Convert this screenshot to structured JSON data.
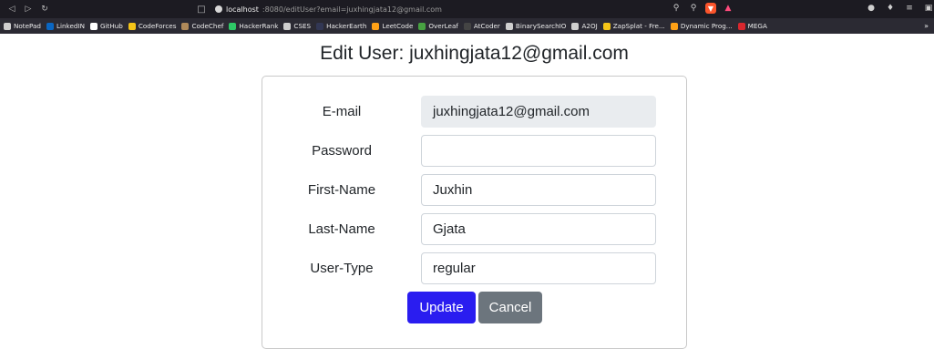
{
  "browser": {
    "url_host": "localhost",
    "url_path": ":8080/editUser?email=juxhingjata12@gmail.com"
  },
  "bookmarks": [
    {
      "label": "NotePad",
      "icon": "notepad-icon",
      "color": "#cfcfcf"
    },
    {
      "label": "LinkedIN",
      "icon": "linkedin-icon",
      "color": "#0a66c2"
    },
    {
      "label": "GitHub",
      "icon": "github-icon",
      "color": "#ffffff"
    },
    {
      "label": "CodeForces",
      "icon": "codeforces-icon",
      "color": "#f5c518"
    },
    {
      "label": "CodeChef",
      "icon": "codechef-icon",
      "color": "#b08a5a"
    },
    {
      "label": "HackerRank",
      "icon": "hackerrank-icon",
      "color": "#2ec866"
    },
    {
      "label": "CSES",
      "icon": "cses-icon",
      "color": "#cfcfcf"
    },
    {
      "label": "HackerEarth",
      "icon": "hackerearth-icon",
      "color": "#323754"
    },
    {
      "label": "LeetCode",
      "icon": "leetcode-icon",
      "color": "#ffa116"
    },
    {
      "label": "OverLeaf",
      "icon": "overleaf-icon",
      "color": "#47a141"
    },
    {
      "label": "AtCoder",
      "icon": "atcoder-icon",
      "color": "#444444"
    },
    {
      "label": "BinarySearchIO",
      "icon": "binarysearch-icon",
      "color": "#cfcfcf"
    },
    {
      "label": "A2OJ",
      "icon": "a2oj-icon",
      "color": "#cfcfcf"
    },
    {
      "label": "ZapSplat - Fre...",
      "icon": "zapsplat-icon",
      "color": "#f5c518"
    },
    {
      "label": "Dynamic Prog...",
      "icon": "dynamic-prog-icon",
      "color": "#ffa116"
    },
    {
      "label": "MEGA",
      "icon": "mega-icon",
      "color": "#d9272e"
    }
  ],
  "page": {
    "title": "Edit User: juxhingjata12@gmail.com"
  },
  "form": {
    "email_label": "E-mail",
    "email_value": "juxhingjata12@gmail.com",
    "password_label": "Password",
    "password_value": "",
    "first_name_label": "First-Name",
    "first_name_value": "Juxhin",
    "last_name_label": "Last-Name",
    "last_name_value": "Gjata",
    "user_type_label": "User-Type",
    "user_type_value": "regular",
    "update_label": "Update",
    "cancel_label": "Cancel"
  },
  "colors": {
    "update_button": "#2a1df0",
    "cancel_button": "#6c757d"
  }
}
